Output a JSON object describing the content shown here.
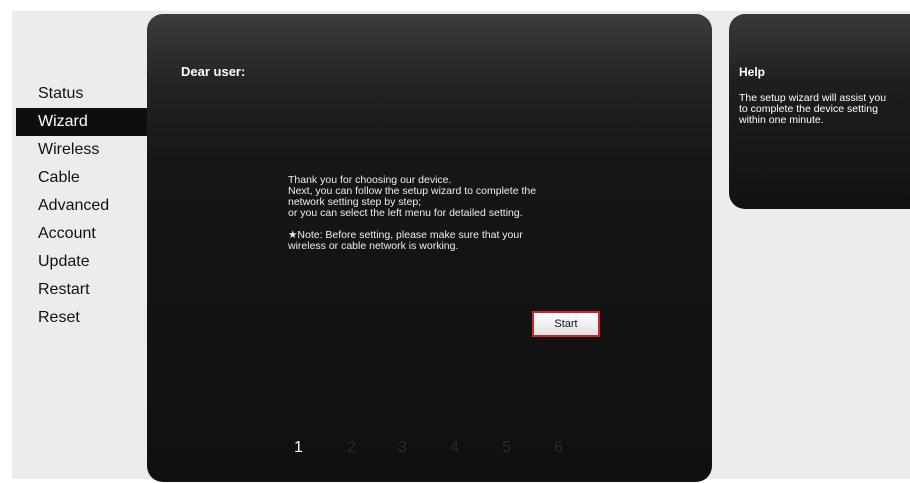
{
  "sidebar": {
    "items": [
      {
        "label": "Status"
      },
      {
        "label": "Wizard",
        "active": true
      },
      {
        "label": "Wireless"
      },
      {
        "label": "Cable"
      },
      {
        "label": "Advanced"
      },
      {
        "label": "Account"
      },
      {
        "label": "Update"
      },
      {
        "label": "Restart"
      },
      {
        "label": "Reset"
      }
    ]
  },
  "main": {
    "greeting": "Dear user:",
    "intro_lines": [
      "Thank you for choosing our device.",
      "Next, you can follow the setup wizard to complete the",
      "network setting step by step;",
      "or you can select the left menu for detailed setting."
    ],
    "note_lines": [
      "★Note: Before setting, please make sure that your",
      "wireless or cable network is working."
    ],
    "start_label": "Start",
    "steps": [
      "1",
      "2",
      "3",
      "4",
      "5",
      "6"
    ],
    "current_step": "1"
  },
  "help": {
    "title": "Help",
    "lines": [
      "The setup wizard will assist you",
      "to complete the device setting",
      "within one minute."
    ]
  },
  "colors": {
    "accent_border": "#c8262b",
    "panel_dark": "#101010",
    "active_nav_bg": "#0e0e0e"
  }
}
